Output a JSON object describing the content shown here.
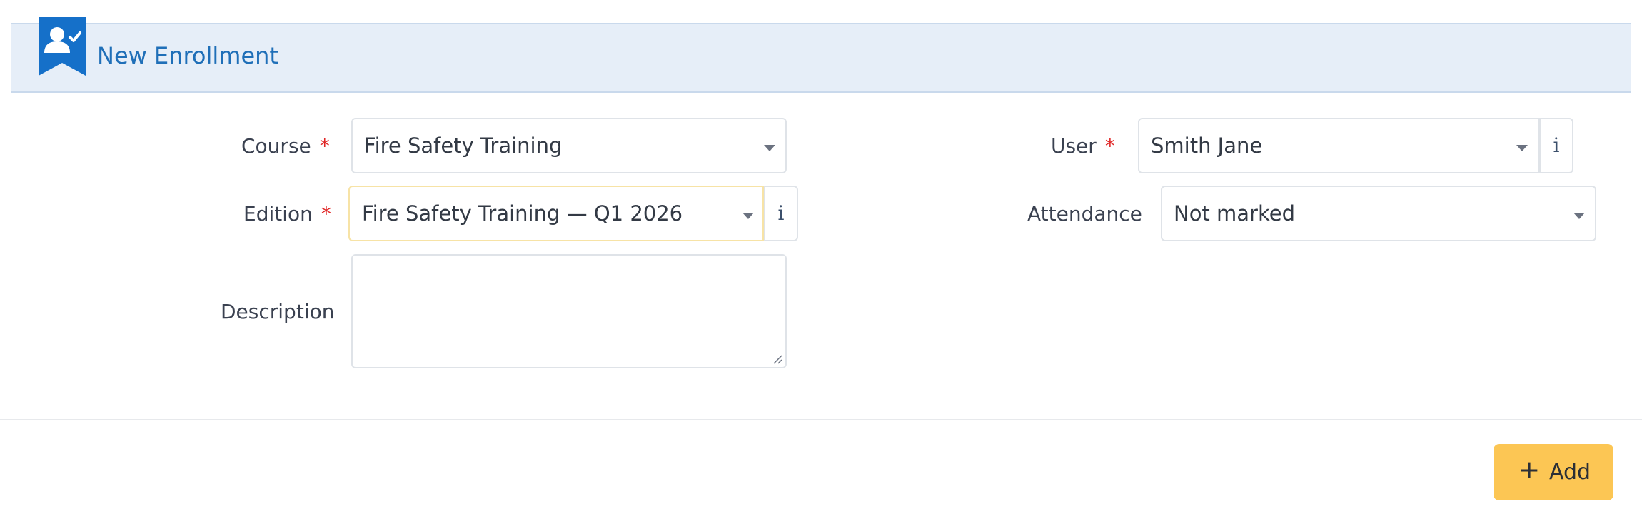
{
  "header": {
    "title": "New Enrollment",
    "icon": "user-check-icon"
  },
  "form": {
    "course": {
      "label": "Course",
      "required_mark": "*",
      "value": "Fire Safety Training"
    },
    "edition": {
      "label": "Edition",
      "required_mark": "*",
      "value": "Fire Safety Training — Q1 2026",
      "info_label": "i"
    },
    "description": {
      "label": "Description",
      "value": ""
    },
    "user": {
      "label": "User",
      "required_mark": "*",
      "value": "Smith Jane",
      "info_label": "i"
    },
    "attendance": {
      "label": "Attendance",
      "value": "Not marked"
    }
  },
  "actions": {
    "add_label": "Add",
    "add_icon": "plus-icon"
  },
  "colors": {
    "accent": "#1f6fb8",
    "header_bg": "#e6eef8",
    "required": "#e02424",
    "add_button": "#fcc654",
    "focus_border": "#f7e3a6"
  }
}
